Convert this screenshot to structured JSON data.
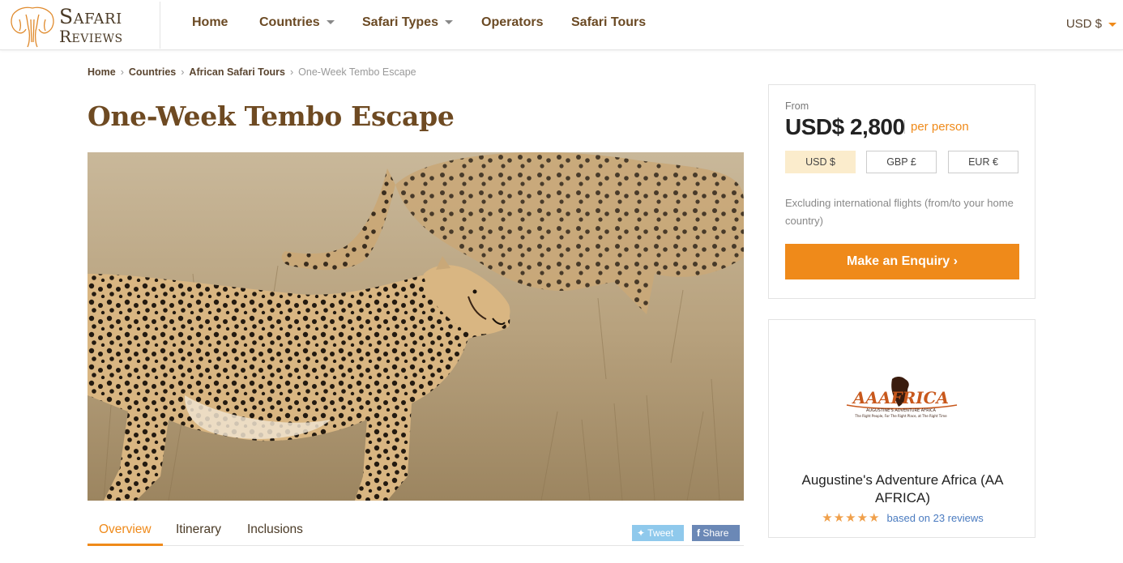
{
  "header": {
    "logo_line1": "Safari",
    "logo_line2": "Reviews",
    "nav": [
      {
        "label": "Home",
        "has_dropdown": false
      },
      {
        "label": "Countries",
        "has_dropdown": true
      },
      {
        "label": "Safari Types",
        "has_dropdown": true
      },
      {
        "label": "Operators",
        "has_dropdown": false
      },
      {
        "label": "Safari Tours",
        "has_dropdown": false
      }
    ],
    "currency": "USD $"
  },
  "breadcrumb": {
    "items": [
      "Home",
      "Countries",
      "African Safari Tours"
    ],
    "current": "One-Week Tembo Escape"
  },
  "page": {
    "title": "One-Week Tembo Escape",
    "hero_alt": "cheetah-photo"
  },
  "tabs": {
    "items": [
      "Overview",
      "Itinerary",
      "Inclusions"
    ],
    "active": "Overview",
    "tweet_label": "Tweet",
    "share_label": "Share"
  },
  "pricing": {
    "from_label": "From",
    "price": "USD$ 2,800",
    "per_person": "per person",
    "currencies": [
      "USD $",
      "GBP £",
      "EUR €"
    ],
    "selected_currency": "USD $",
    "note": "Excluding international flights (from/to your home country)",
    "enquiry_label": "Make an Enquiry"
  },
  "operator": {
    "logo_text": "AAAFRICA",
    "logo_subtitle": "AUGUSTINE'S ADVENTURE AFRICA",
    "logo_tagline": "The Right People, For The Right Place, at The Right Time",
    "name": "Augustine's Adventure Africa (AA AFRICA)",
    "stars": "★★★★★",
    "rating": 5,
    "reviews_text": "based on 23 reviews"
  },
  "colors": {
    "accent": "#ef8a1a",
    "brand_brown": "#6e4a22",
    "link_blue": "#4a7bc0"
  }
}
